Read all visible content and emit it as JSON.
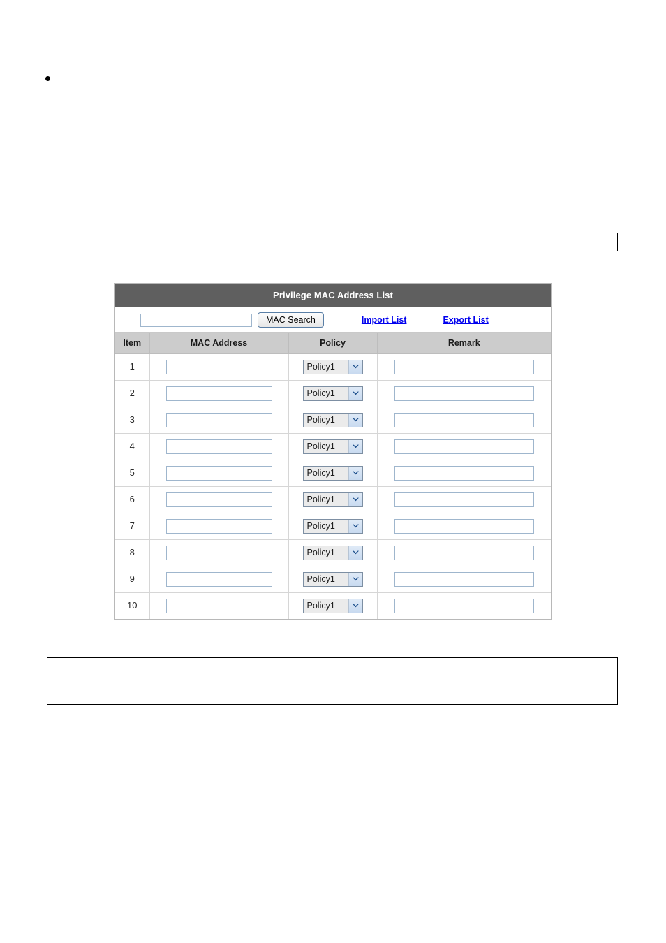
{
  "bullet": {
    "text": ""
  },
  "note_top": {
    "text": ""
  },
  "note_bottom": {
    "text": ""
  },
  "panel": {
    "title": "Privilege MAC Address List",
    "toolbar": {
      "search_value": "",
      "search_placeholder": "",
      "search_button_label": "MAC Search",
      "import_link_label": "Import List",
      "export_link_label": "Export List"
    },
    "columns": [
      {
        "key": "item",
        "label": "Item"
      },
      {
        "key": "mac",
        "label": "MAC Address"
      },
      {
        "key": "policy",
        "label": "Policy"
      },
      {
        "key": "remark",
        "label": "Remark"
      }
    ],
    "policy_options": [
      "Policy1"
    ],
    "rows": [
      {
        "item": "1",
        "mac": "",
        "policy": "Policy1",
        "remark": ""
      },
      {
        "item": "2",
        "mac": "",
        "policy": "Policy1",
        "remark": ""
      },
      {
        "item": "3",
        "mac": "",
        "policy": "Policy1",
        "remark": ""
      },
      {
        "item": "4",
        "mac": "",
        "policy": "Policy1",
        "remark": ""
      },
      {
        "item": "5",
        "mac": "",
        "policy": "Policy1",
        "remark": ""
      },
      {
        "item": "6",
        "mac": "",
        "policy": "Policy1",
        "remark": ""
      },
      {
        "item": "7",
        "mac": "",
        "policy": "Policy1",
        "remark": ""
      },
      {
        "item": "8",
        "mac": "",
        "policy": "Policy1",
        "remark": ""
      },
      {
        "item": "9",
        "mac": "",
        "policy": "Policy1",
        "remark": ""
      },
      {
        "item": "10",
        "mac": "",
        "policy": "Policy1",
        "remark": ""
      }
    ]
  },
  "colors": {
    "title_bar": "#5f5f5f",
    "header_row": "#cccccc",
    "link": "#0000ee",
    "input_border": "#9fb6cd"
  }
}
